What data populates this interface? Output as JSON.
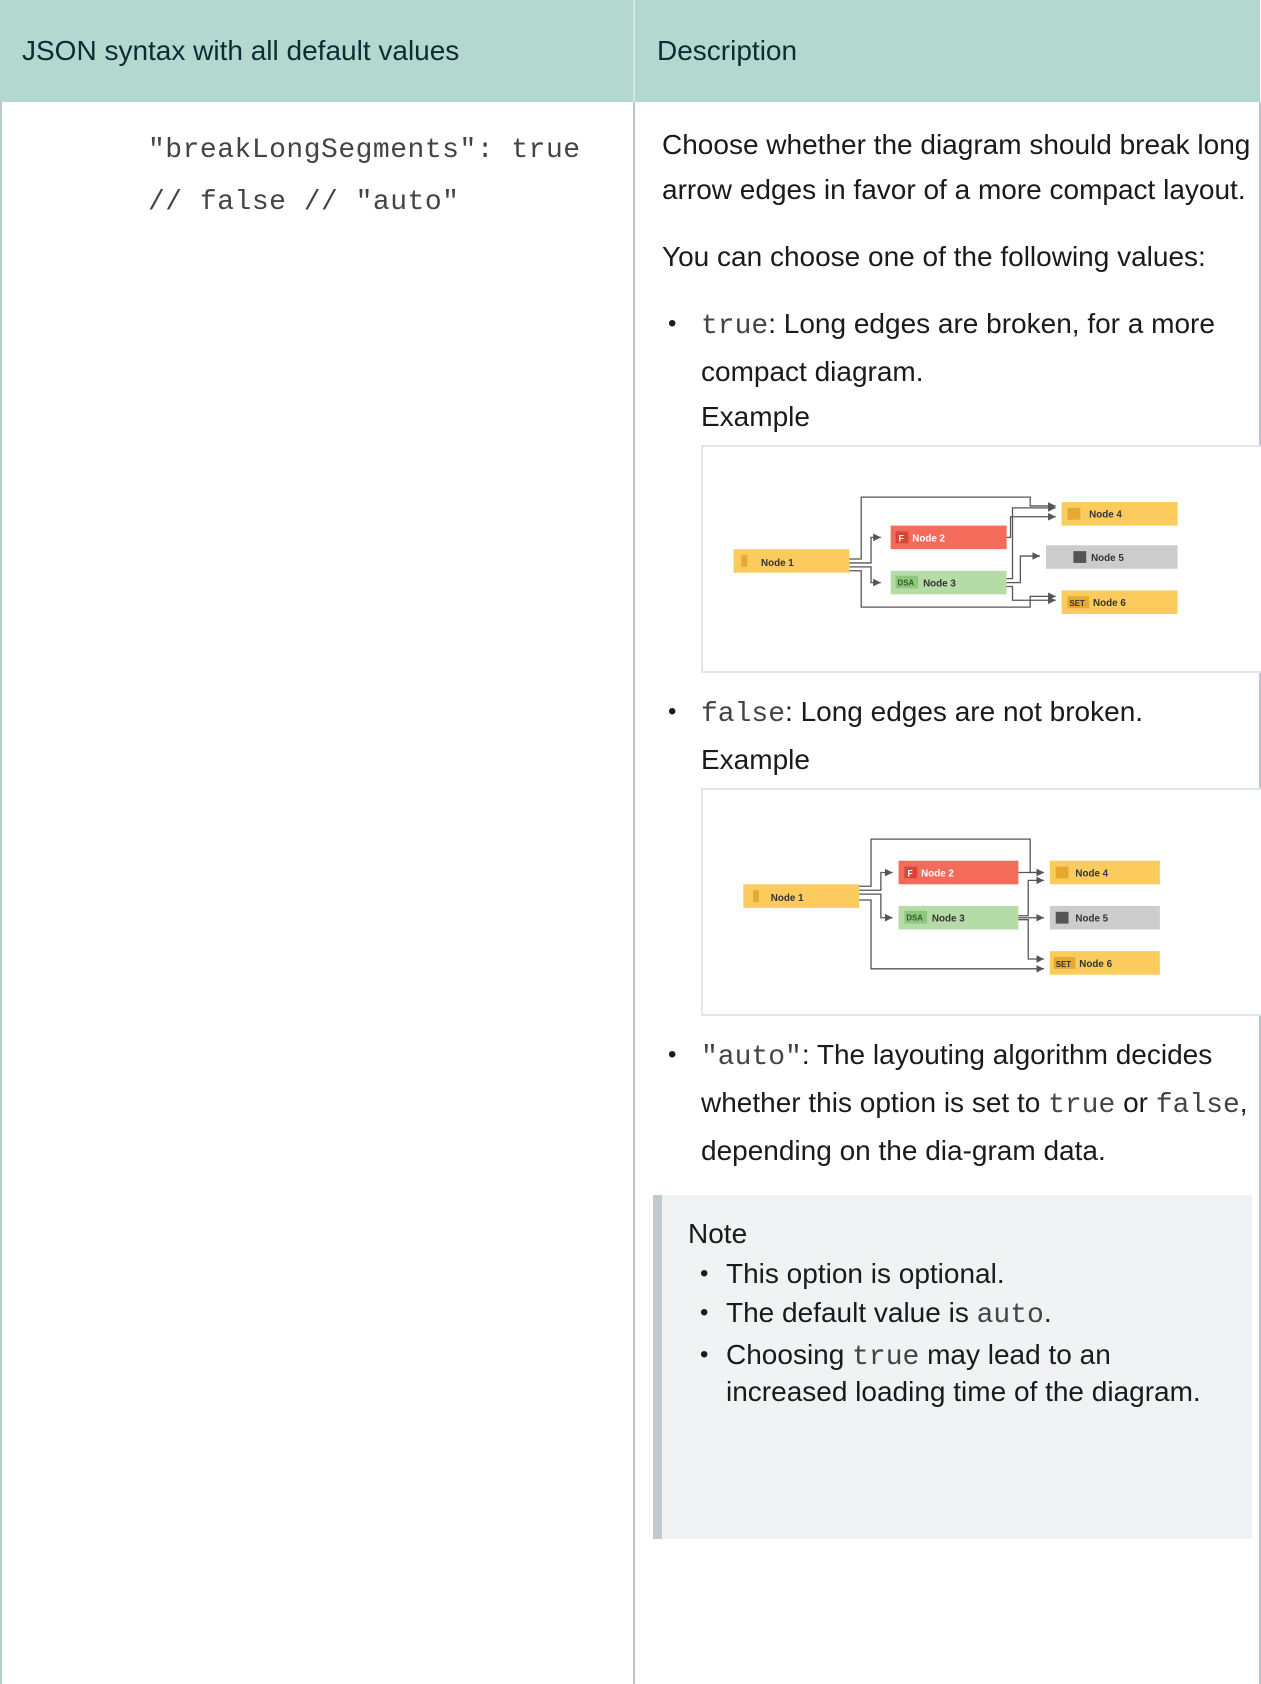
{
  "table": {
    "header_col1": "JSON syntax with all default values",
    "header_col2": "Description"
  },
  "code": {
    "line1": "\"breakLongSegments\": true",
    "line2": "// false // \"auto\""
  },
  "description": {
    "intro": "Choose whether the diagram should break long arrow edges in favor of a more compact layout.",
    "choose": "You can choose one of the following values:",
    "options": [
      {
        "value": "true",
        "text": ": Long edges are broken, for a more compact diagram.",
        "example": "Example"
      },
      {
        "value": "false",
        "text": ": Long edges are not broken.",
        "example": "Example"
      },
      {
        "value": "\"auto\"",
        "text_a": ": The layouting algorithm decides whether this option is set to ",
        "code_a": "true",
        "text_b": " or ",
        "code_b": "false",
        "text_c": ", depending on the dia-gram data."
      }
    ]
  },
  "diagram_labels": {
    "node1": "Node 1",
    "node2": "Node 2",
    "node3": "Node 3",
    "node4": "Node 4",
    "node5": "Node 5",
    "node6": "Node 6",
    "tag_f": "F",
    "tag_dsa": "DSA",
    "tag_set": "SET"
  },
  "diagram_colors": {
    "node1": "#fccb5e",
    "node2": "#f26b5b",
    "node3": "#b5dca6",
    "node4": "#fccb5e",
    "node5": "#cccccc",
    "node6": "#fccb5e",
    "edge": "#555555"
  },
  "note": {
    "title": "Note",
    "item1": "This option is optional.",
    "item2_a": "The default value is ",
    "item2_code": "auto",
    "item2_b": ".",
    "item3_a": "Choosing ",
    "item3_code": "true",
    "item3_b": " may lead to an increased loading time of the diagram."
  }
}
